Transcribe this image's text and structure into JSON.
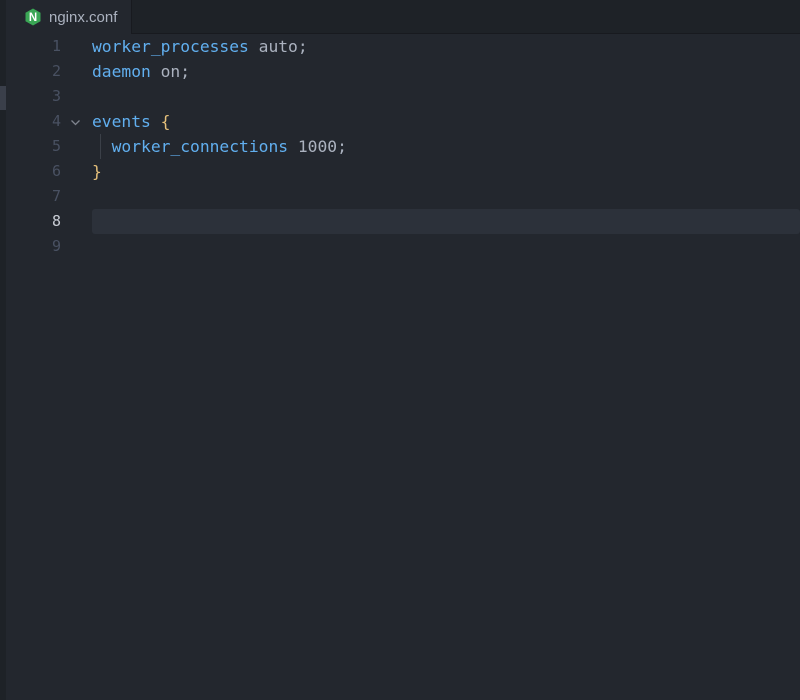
{
  "tab": {
    "filename": "nginx.conf",
    "icon": "nginx-icon",
    "icon_letter": "N",
    "icon_color": "#3aa655"
  },
  "editor": {
    "current_line": 8,
    "lines": [
      {
        "number": "1",
        "tokens": [
          {
            "t": "worker_processes",
            "k": "kw"
          },
          {
            "t": " auto;",
            "k": "val"
          }
        ]
      },
      {
        "number": "2",
        "tokens": [
          {
            "t": "daemon",
            "k": "kw"
          },
          {
            "t": " on;",
            "k": "val"
          }
        ]
      },
      {
        "number": "3",
        "tokens": []
      },
      {
        "number": "4",
        "fold": true,
        "tokens": [
          {
            "t": "events",
            "k": "kw"
          },
          {
            "t": " ",
            "k": "val"
          },
          {
            "t": "{",
            "k": "brace"
          }
        ]
      },
      {
        "number": "5",
        "indent": true,
        "tokens": [
          {
            "t": "  ",
            "k": "val"
          },
          {
            "t": "worker_connections",
            "k": "kw"
          },
          {
            "t": " 1000;",
            "k": "val"
          }
        ]
      },
      {
        "number": "6",
        "tokens": [
          {
            "t": "}",
            "k": "brace"
          }
        ]
      },
      {
        "number": "7",
        "tokens": []
      },
      {
        "number": "8",
        "tokens": []
      },
      {
        "number": "9",
        "tokens": []
      }
    ]
  },
  "colors": {
    "background": "#23272e",
    "keyword": "#61afef",
    "brace": "#e5c07b",
    "text": "#abb2bf",
    "line_number": "#495162",
    "current_line_number": "#c8ccd4"
  }
}
